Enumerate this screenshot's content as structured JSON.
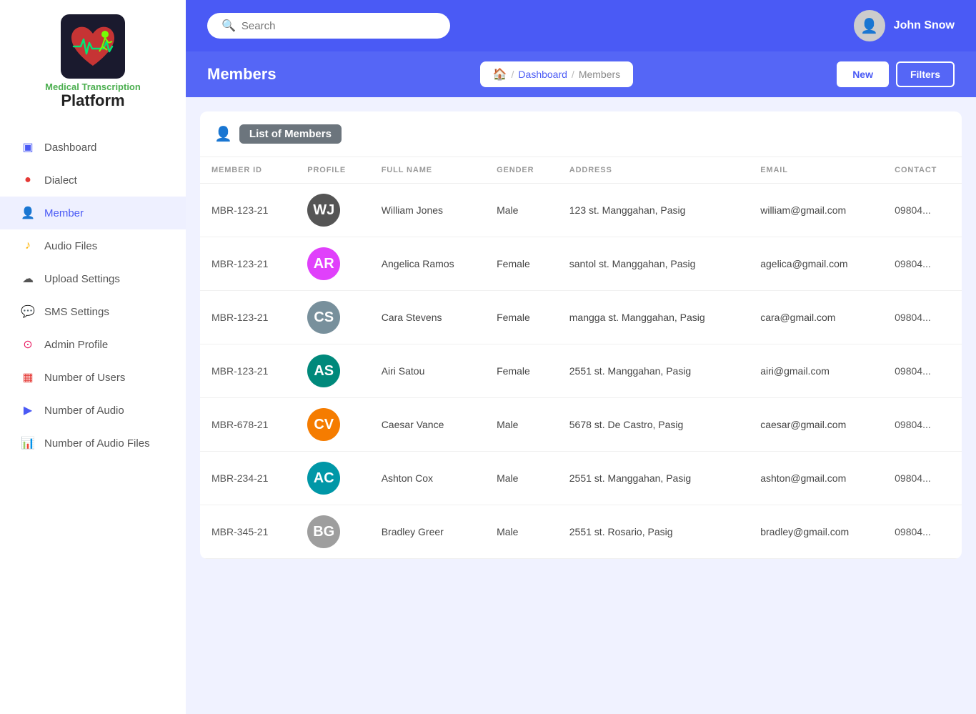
{
  "app": {
    "title_green": "Medical Transcription",
    "title_black": "Platform"
  },
  "header": {
    "search_placeholder": "Search",
    "user_name": "John Snow"
  },
  "subheader": {
    "page_title": "Members",
    "breadcrumb": {
      "home_label": "🏠",
      "dashboard_label": "Dashboard",
      "current_label": "Members",
      "separator": "/"
    },
    "btn_new": "New",
    "btn_filters": "Filters"
  },
  "members_card": {
    "section_title": "List of Members",
    "columns": [
      "MEMBER ID",
      "PROFILE",
      "FULL NAME",
      "GENDER",
      "ADDRESS",
      "EMAIL",
      "CONTACT"
    ],
    "rows": [
      {
        "id": "MBR-123-21",
        "full_name": "William Jones",
        "gender": "Male",
        "address": "123 st. Manggahan, Pasig",
        "email": "william@gmail.com",
        "contact": "09804...",
        "avatar_color": "#555",
        "avatar_initials": "WJ"
      },
      {
        "id": "MBR-123-21",
        "full_name": "Angelica Ramos",
        "gender": "Female",
        "address": "santol st. Manggahan, Pasig",
        "email": "agelica@gmail.com",
        "contact": "09804...",
        "avatar_color": "#e040fb",
        "avatar_initials": "AR"
      },
      {
        "id": "MBR-123-21",
        "full_name": "Cara Stevens",
        "gender": "Female",
        "address": "mangga st. Manggahan, Pasig",
        "email": "cara@gmail.com",
        "contact": "09804...",
        "avatar_color": "#78909c",
        "avatar_initials": "CS"
      },
      {
        "id": "MBR-123-21",
        "full_name": "Airi Satou",
        "gender": "Female",
        "address": "2551 st. Manggahan, Pasig",
        "email": "airi@gmail.com",
        "contact": "09804...",
        "avatar_color": "#00897b",
        "avatar_initials": "AS"
      },
      {
        "id": "MBR-678-21",
        "full_name": "Caesar Vance",
        "gender": "Male",
        "address": "5678 st. De Castro, Pasig",
        "email": "caesar@gmail.com",
        "contact": "09804...",
        "avatar_color": "#f57c00",
        "avatar_initials": "CV"
      },
      {
        "id": "MBR-234-21",
        "full_name": "Ashton Cox",
        "gender": "Male",
        "address": "2551 st. Manggahan, Pasig",
        "email": "ashton@gmail.com",
        "contact": "09804...",
        "avatar_color": "#0097a7",
        "avatar_initials": "AC"
      },
      {
        "id": "MBR-345-21",
        "full_name": "Bradley Greer",
        "gender": "Male",
        "address": "2551 st. Rosario, Pasig",
        "email": "bradley@gmail.com",
        "contact": "09804...",
        "avatar_color": "#9e9e9e",
        "avatar_initials": "BG"
      }
    ]
  },
  "sidebar": {
    "items": [
      {
        "label": "Dashboard",
        "icon": "▣",
        "name": "dashboard"
      },
      {
        "label": "Dialect",
        "icon": "●",
        "name": "dialect",
        "icon_color": "#e53935"
      },
      {
        "label": "Member",
        "icon": "👤",
        "name": "member"
      },
      {
        "label": "Audio Files",
        "icon": "♪",
        "name": "audio-files",
        "icon_color": "#ffb300"
      },
      {
        "label": "Upload Settings",
        "icon": "☁",
        "name": "upload-settings"
      },
      {
        "label": "SMS Settings",
        "icon": "💬",
        "name": "sms-settings",
        "icon_color": "#4fc3f7"
      },
      {
        "label": "Admin Profile",
        "icon": "⊙",
        "name": "admin-profile",
        "icon_color": "#e91e63"
      },
      {
        "label": "Number of Users",
        "icon": "▦",
        "name": "number-of-users",
        "icon_color": "#e53935"
      },
      {
        "label": "Number of Audio",
        "icon": "▶",
        "name": "number-of-audio",
        "icon_color": "#4a5af5"
      },
      {
        "label": "Number of Audio Files",
        "icon": "📊",
        "name": "number-of-audio-files",
        "icon_color": "#4caf50"
      }
    ]
  }
}
